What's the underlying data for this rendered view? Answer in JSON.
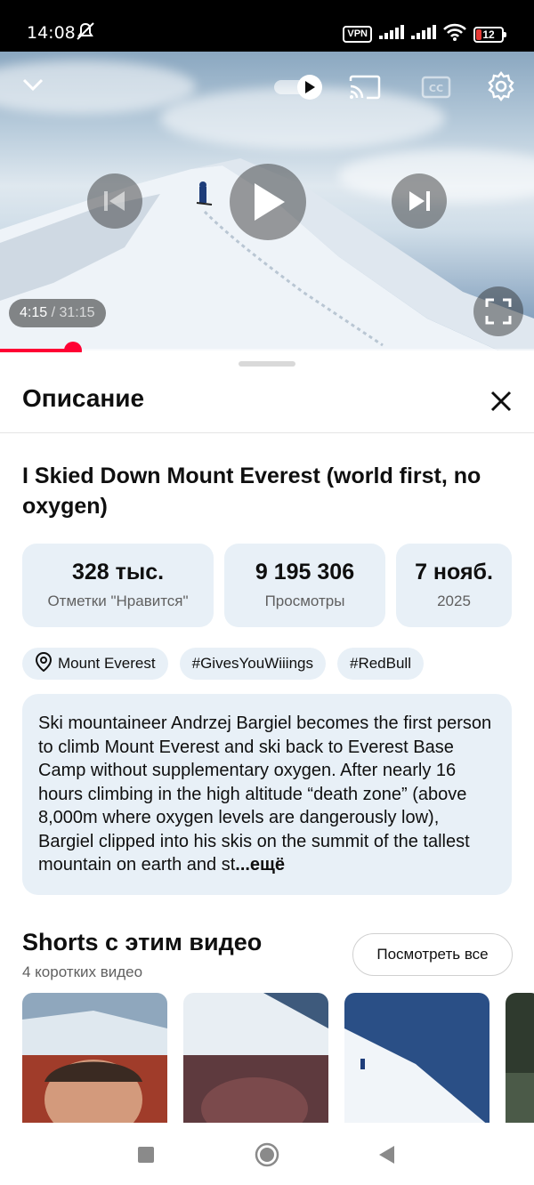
{
  "status_bar": {
    "time": "14:08",
    "vpn": "VPN",
    "battery": "12"
  },
  "player": {
    "current_time": "4:15",
    "duration": "31:15",
    "progress_fraction": 0.136,
    "accent_color": "#ff0033"
  },
  "sheet": {
    "title": "Описание",
    "video_title": "I Skied Down Mount Everest (world first, no oxygen)",
    "stats": [
      {
        "value": "328 тыс.",
        "label": "Отметки \"Нравится\""
      },
      {
        "value": "9 195 306",
        "label": "Просмотры"
      },
      {
        "value": "7 нояб.",
        "label": "2025"
      }
    ],
    "tags": [
      {
        "label": "Mount Everest",
        "icon": "location-pin-icon"
      },
      {
        "label": "#GivesYouWiiings"
      },
      {
        "label": "#RedBull"
      }
    ],
    "description": "Ski mountaineer Andrzej Bargiel becomes the first person to climb Mount Everest and ski back to Everest Base Camp without supplementary oxygen. After nearly 16 hours climbing in the high altitude “death zone” (above 8,000m where oxygen levels are dangerously low), Bargiel clipped into his skis on the summit of the tallest mountain on earth and st",
    "more": "...ещё"
  },
  "shorts": {
    "title": "Shorts с этим видео",
    "subtitle": "4 коротких видео",
    "see_all": "Посмотреть все"
  }
}
